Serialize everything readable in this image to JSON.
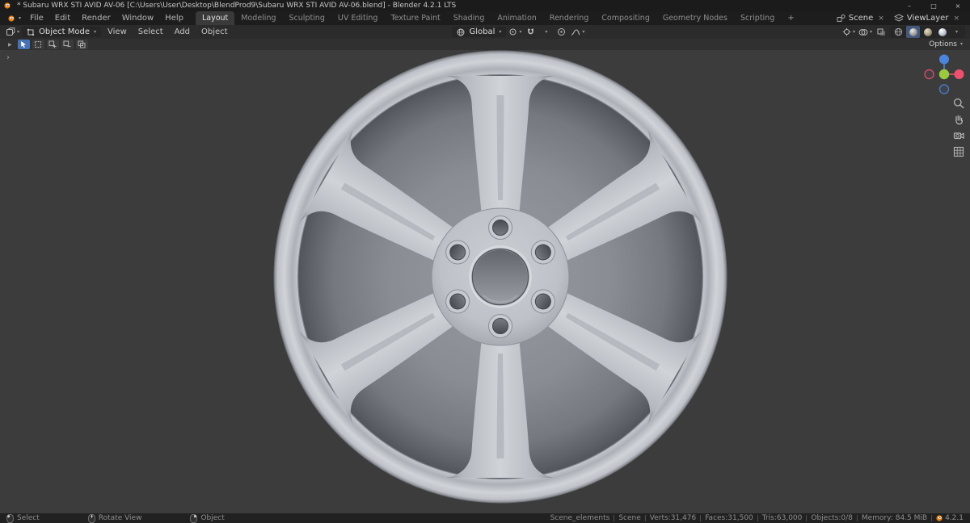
{
  "icons": {
    "chevron": "▾",
    "play_arrow": "▶",
    "expand_arrow": "›",
    "minimize": "–",
    "maximize": "□",
    "close": "×",
    "unlink": "×",
    "add_tab": "+"
  },
  "colors": {
    "accent": "#4772b3",
    "axis_x": "#ee5170",
    "axis_y": "#9ac83f",
    "axis_z": "#4a84dd"
  },
  "title_bar": {
    "title": "* Subaru WRX STI AVID AV-06 [C:\\Users\\User\\Desktop\\BlendProd9\\Subaru WRX STI AVID AV-06.blend] - Blender 4.2.1 LTS"
  },
  "menu_bar": {
    "menus": [
      "File",
      "Edit",
      "Render",
      "Window",
      "Help"
    ],
    "tabs": [
      "Layout",
      "Modeling",
      "Sculpting",
      "UV Editing",
      "Texture Paint",
      "Shading",
      "Animation",
      "Rendering",
      "Compositing",
      "Geometry Nodes",
      "Scripting"
    ],
    "active_tab": "Layout",
    "scene": "Scene",
    "view_layer": "ViewLayer"
  },
  "tool_header": {
    "mode": "Object Mode",
    "menus": [
      "View",
      "Select",
      "Add",
      "Object"
    ],
    "orientation": "Global"
  },
  "tool_settings": {
    "options": "Options"
  },
  "status_bar": {
    "hints": [
      {
        "label": "Select"
      },
      {
        "label": "Rotate View"
      },
      {
        "label": "Object"
      }
    ],
    "stats": [
      "Scene_elements",
      "Scene",
      "Verts:31,476",
      "Faces:31,500",
      "Tris:63,000",
      "Objects:0/8",
      "Memory: 84.5 MiB",
      "4.2.1"
    ]
  }
}
